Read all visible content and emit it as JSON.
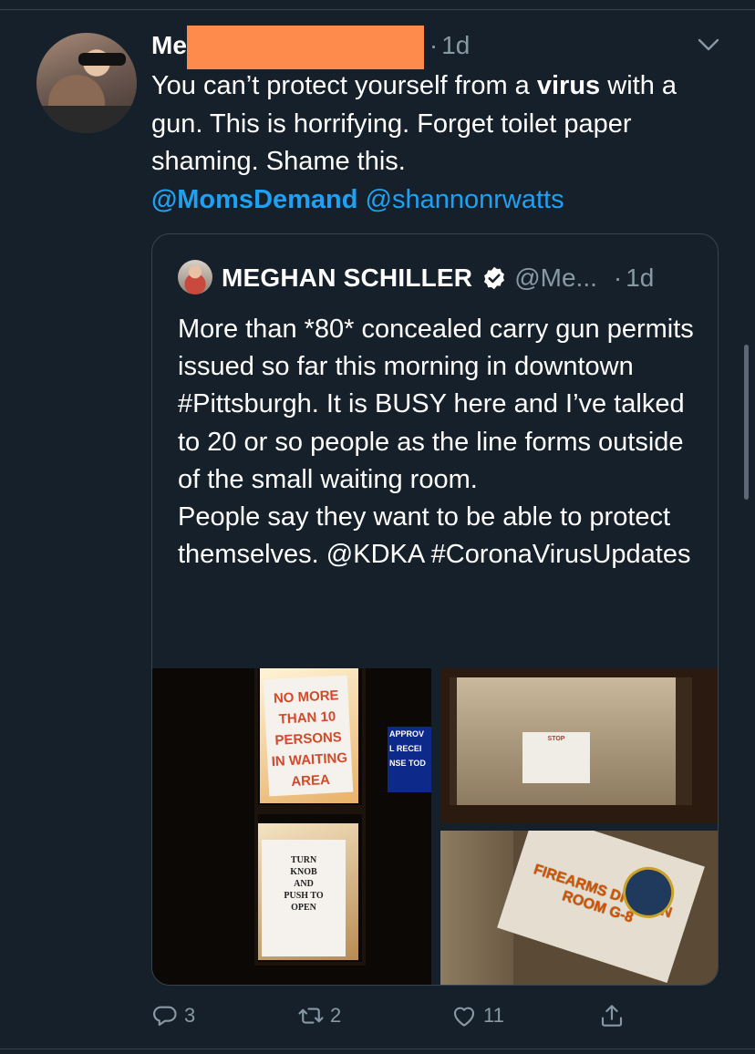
{
  "tweet": {
    "author_visible_prefix": "Me",
    "dot": "·",
    "time": "1d",
    "text_parts": {
      "p1": "You can’t protect yourself from a ",
      "bold": "virus",
      "p2": " with a gun. This is horrifying. Forget toilet paper shaming. Shame this.",
      "mention1": "@MomsDemand",
      "mention2": "@shannonrwatts"
    },
    "redaction_color": "#fe8a4b"
  },
  "quote": {
    "name": "MEGHAN SCHILLER",
    "handle": "@Me...",
    "dot": "·",
    "time": "1d",
    "para1": "More than *80* concealed carry gun permits issued so far this morning in downtown #Pittsburgh. It is BUSY here and I’ve talked to 20 or so people as the line forms outside of the small waiting room.",
    "para2": "People say they want to be able to protect themselves. @KDKA #CoronaVirusUpdates",
    "media": {
      "sign_top": [
        "NO MORE",
        "THAN 10",
        "PERSONS",
        "IN WAITING",
        "AREA"
      ],
      "sign_bottom": [
        "TURN",
        "KNOB",
        "AND",
        "PUSH TO",
        "OPEN"
      ],
      "blue_sign": [
        "APPROV",
        "L RECEI",
        "NSE TOD"
      ],
      "stop_sign": "STOP",
      "firearms_sign": [
        "FIREARMS DIVISION",
        "ROOM G-8"
      ]
    }
  },
  "actions": {
    "reply_count": "3",
    "retweet_count": "2",
    "like_count": "11"
  },
  "colors": {
    "background": "#15202b",
    "accent": "#1da1f2",
    "muted": "#8899a6",
    "border": "#38444d"
  }
}
